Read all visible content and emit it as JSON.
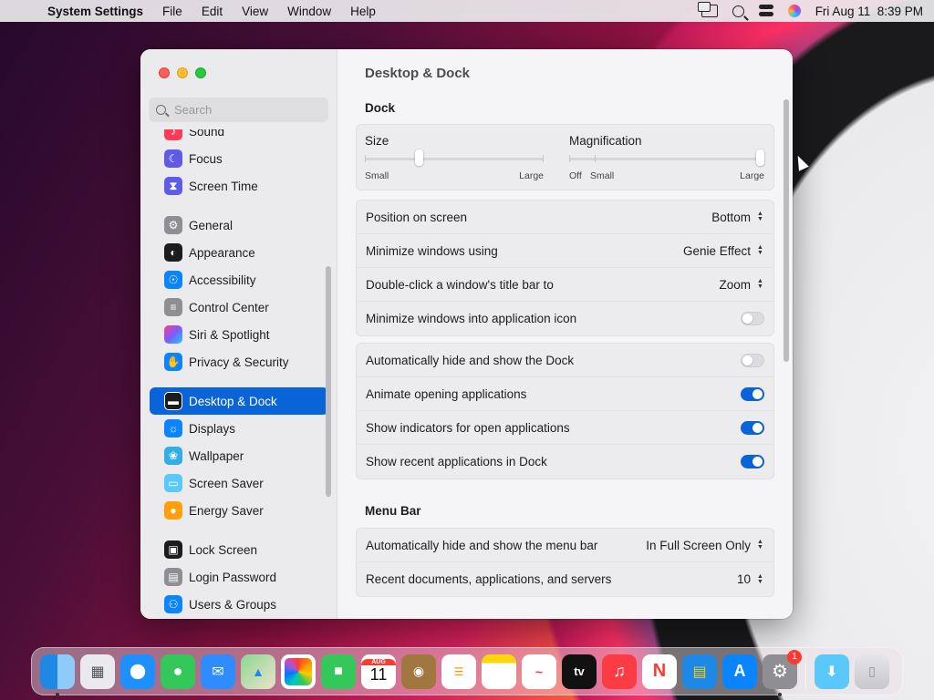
{
  "menubar": {
    "app_name": "System Settings",
    "menus": [
      "File",
      "Edit",
      "View",
      "Window",
      "Help"
    ],
    "clock": "Fri Aug 11  8:39 PM"
  },
  "window": {
    "title": "Desktop & Dock",
    "search": {
      "placeholder": "Search"
    }
  },
  "sidebar": {
    "items": [
      {
        "label": "Sound",
        "icon": "sound-icon",
        "color": "#ff3b5c"
      },
      {
        "label": "Focus",
        "icon": "moon-icon",
        "color": "#5e5ce6"
      },
      {
        "label": "Screen Time",
        "icon": "hourglass-icon",
        "color": "#5e5ce6"
      },
      {
        "label": "General",
        "icon": "gear-icon",
        "color": "#8e8e93"
      },
      {
        "label": "Appearance",
        "icon": "appearance-icon",
        "color": "#1c1c1e"
      },
      {
        "label": "Accessibility",
        "icon": "accessibility-icon",
        "color": "#0a84ff"
      },
      {
        "label": "Control Center",
        "icon": "control-center-icon",
        "color": "#8e8e93"
      },
      {
        "label": "Siri & Spotlight",
        "icon": "siri-icon",
        "color": "#a64ad8"
      },
      {
        "label": "Privacy & Security",
        "icon": "hand-icon",
        "color": "#0a84ff"
      },
      {
        "label": "Desktop & Dock",
        "icon": "dock-icon",
        "color": "#1c1c1e"
      },
      {
        "label": "Displays",
        "icon": "sun-icon",
        "color": "#0a84ff"
      },
      {
        "label": "Wallpaper",
        "icon": "flower-icon",
        "color": "#32ade6"
      },
      {
        "label": "Screen Saver",
        "icon": "screen-saver-icon",
        "color": "#5ac8fa"
      },
      {
        "label": "Energy Saver",
        "icon": "lightbulb-icon",
        "color": "#ff9f0a"
      },
      {
        "label": "Lock Screen",
        "icon": "lock-icon",
        "color": "#1c1c1e"
      },
      {
        "label": "Login Password",
        "icon": "padlock-icon",
        "color": "#8e8e93"
      },
      {
        "label": "Users & Groups",
        "icon": "users-icon",
        "color": "#0a84ff"
      }
    ]
  },
  "dock_section": {
    "title": "Dock",
    "size_label": "Size",
    "size_min": "Small",
    "size_max": "Large",
    "size_value": 0.3,
    "magnification_label": "Magnification",
    "mag_off": "Off",
    "mag_min": "Small",
    "mag_max": "Large",
    "magnification_value": 1.0,
    "rows": [
      {
        "label": "Position on screen",
        "value": "Bottom"
      },
      {
        "label": "Minimize windows using",
        "value": "Genie Effect"
      },
      {
        "label": "Double-click a window's title bar to",
        "value": "Zoom"
      },
      {
        "label": "Minimize windows into application icon",
        "toggle": false
      }
    ],
    "toggles": [
      {
        "label": "Automatically hide and show the Dock",
        "on": false
      },
      {
        "label": "Animate opening applications",
        "on": true
      },
      {
        "label": "Show indicators for open applications",
        "on": true
      },
      {
        "label": "Show recent applications in Dock",
        "on": true
      }
    ]
  },
  "menubar_section": {
    "title": "Menu Bar",
    "rows": [
      {
        "label": "Automatically hide and show the menu bar",
        "value": "In Full Screen Only"
      },
      {
        "label": "Recent documents, applications, and servers",
        "value": "10"
      }
    ]
  },
  "dock": {
    "calendar_month": "AUG",
    "calendar_day": "11",
    "tv_label": "tv",
    "settings_badge": "1"
  }
}
